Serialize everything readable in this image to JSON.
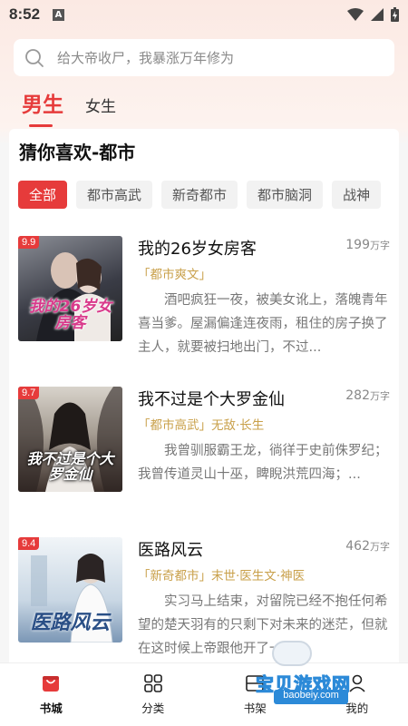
{
  "status_bar": {
    "time": "8:52",
    "notif_letter": "A"
  },
  "search": {
    "placeholder": "给大帝收尸，我暴涨万年修为"
  },
  "tabs": [
    {
      "label": "男生",
      "active": true
    },
    {
      "label": "女生",
      "active": false
    }
  ],
  "section": {
    "title": "猜你喜欢-都市"
  },
  "chips": [
    {
      "label": "全部",
      "active": true
    },
    {
      "label": "都市高武"
    },
    {
      "label": "新奇都市"
    },
    {
      "label": "都市脑洞"
    },
    {
      "label": "战神"
    }
  ],
  "books": [
    {
      "score": "9.9",
      "title": "我的26岁女房客",
      "words": "199",
      "unit": "万字",
      "tags": "「都市爽文」",
      "desc": "酒吧疯狂一夜，被美女讹上，落魄青年喜当爹。屋漏偏逢连夜雨，租住的房子换了主人，就要被扫地出门，不过...",
      "cover_text": "我的26岁女房客",
      "cover_colors": [
        "#7d7f86",
        "#2d2f38"
      ],
      "cover_text_color": "#d93a8b"
    },
    {
      "score": "9.7",
      "title": "我不过是个大罗金仙",
      "words": "282",
      "unit": "万字",
      "tags": "「都市高武」无敌·长生",
      "desc": "我曾驯服霸王龙，徜徉于史前侏罗纪；我曾传道灵山十巫，睥睨洪荒四海；...",
      "cover_text": "我不过是个大罗金仙",
      "cover_colors": [
        "#cfcac2",
        "#3a2e2a"
      ],
      "cover_text_color": "#f3f3f3"
    },
    {
      "score": "9.4",
      "title": "医路风云",
      "words": "462",
      "unit": "万字",
      "tags": "「新奇都市」末世·医生文·神医",
      "desc": "实习马上结束，对留院已经不抱任何希望的楚天羽有的只剩下对未来的迷茫，但就在这时候上帝跟他开了一个...",
      "cover_text": "医路风云",
      "cover_colors": [
        "#e9f0f5",
        "#8fa9c2"
      ],
      "cover_text_color": "#2a4f86"
    }
  ],
  "bottom_nav": [
    {
      "label": "书城",
      "icon": "bookstore-bag-icon",
      "active": true
    },
    {
      "label": "分类",
      "icon": "grid-category-icon"
    },
    {
      "label": "书架",
      "icon": "bookshelf-icon"
    },
    {
      "label": "我的",
      "icon": "profile-icon"
    }
  ],
  "watermark": {
    "text": "宝贝游戏网",
    "url": "baobeiy.com"
  },
  "colors": {
    "accent": "#e63b3b",
    "tag": "#c9a04a"
  }
}
